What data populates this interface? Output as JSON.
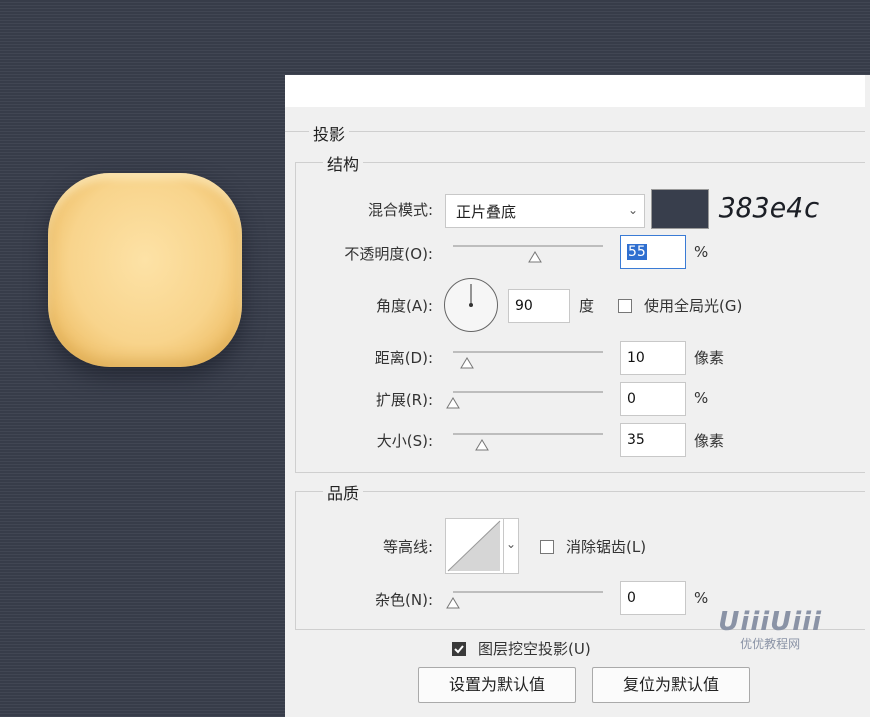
{
  "dialog": {
    "section_title": "投影",
    "structure": {
      "title": "结构",
      "blend_mode": {
        "label": "混合模式:",
        "value": "正片叠底"
      },
      "color": {
        "hex_note": "383e4c",
        "swatch": "#383e4c"
      },
      "opacity": {
        "label": "不透明度(O):",
        "value": "55",
        "unit": "%",
        "fraction": 0.55
      },
      "angle": {
        "label": "角度(A):",
        "value": "90",
        "unit": "度"
      },
      "global_light": {
        "label": "使用全局光(G)",
        "checked": false
      },
      "distance": {
        "label": "距离(D):",
        "value": "10",
        "unit": "像素",
        "fraction": 0.07
      },
      "spread": {
        "label": "扩展(R):",
        "value": "0",
        "unit": "%",
        "fraction": 0.0
      },
      "size": {
        "label": "大小(S):",
        "value": "35",
        "unit": "像素",
        "fraction": 0.2
      }
    },
    "quality": {
      "title": "品质",
      "contour": {
        "label": "等高线:"
      },
      "anti_alias": {
        "label": "消除锯齿(L)",
        "checked": false
      },
      "noise": {
        "label": "杂色(N):",
        "value": "0",
        "unit": "%",
        "fraction": 0.0
      }
    },
    "knockout": {
      "label": "图层挖空投影(U)",
      "checked": true
    },
    "buttons": {
      "make_default": "设置为默认值",
      "reset_default": "复位为默认值"
    }
  },
  "watermark": {
    "logo": "UiiiUiii",
    "subtitle": "优优教程网"
  },
  "colors": {
    "background": "#3a3f4d",
    "shape_fill": "#f8d48c",
    "shadow": "#383e4c"
  }
}
